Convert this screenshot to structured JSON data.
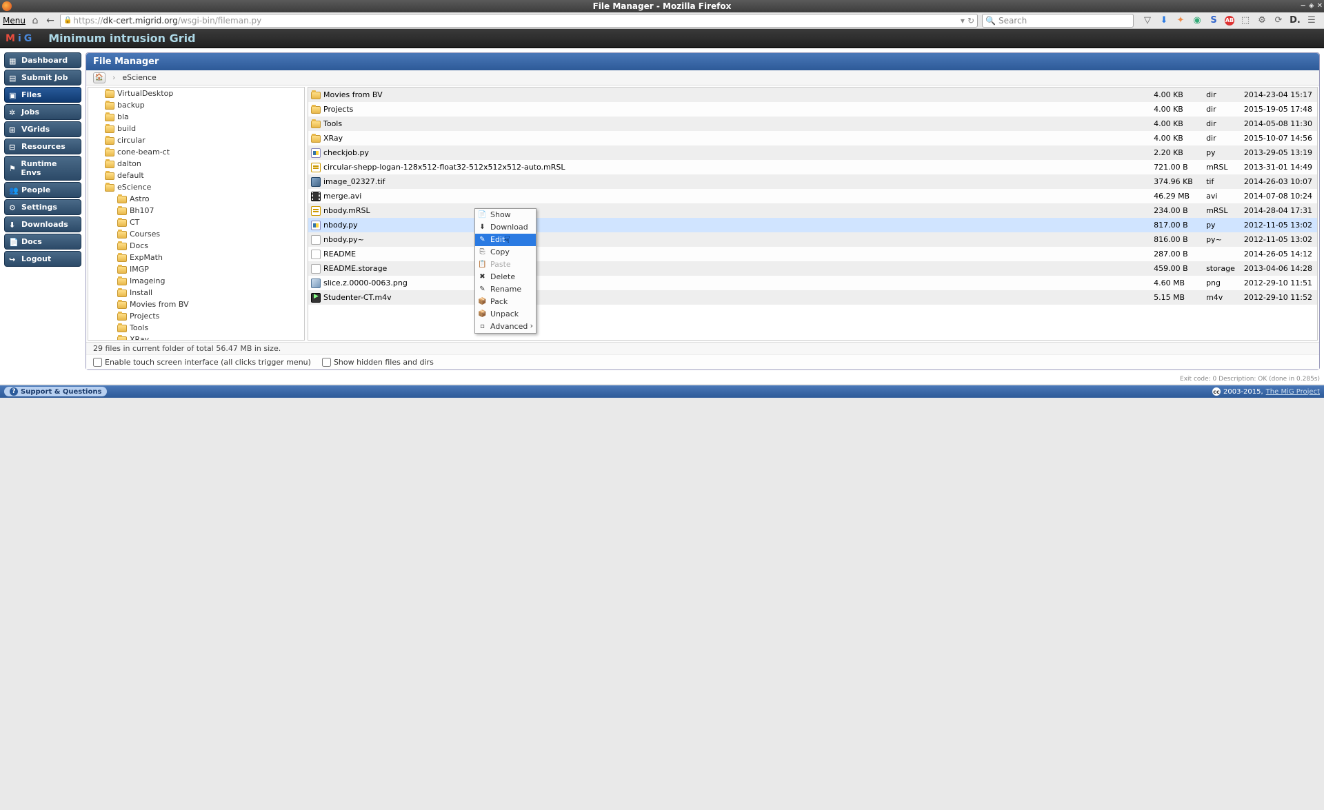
{
  "window": {
    "title": "File Manager - Mozilla Firefox"
  },
  "browser": {
    "menu_label": "Menu",
    "url_proto": "https://",
    "url_host": "dk-cert.migrid.org",
    "url_path": "/wsgi-bin/fileman.py",
    "search_placeholder": "Search"
  },
  "header": {
    "subtitle": "Minimum intrusion Grid"
  },
  "sidebar": [
    {
      "label": "Dashboard",
      "active": false,
      "icon": "dashboard-icon"
    },
    {
      "label": "Submit Job",
      "active": false,
      "icon": "submit-icon"
    },
    {
      "label": "Files",
      "active": true,
      "icon": "files-icon"
    },
    {
      "label": "Jobs",
      "active": false,
      "icon": "jobs-icon"
    },
    {
      "label": "VGrids",
      "active": false,
      "icon": "vgrids-icon"
    },
    {
      "label": "Resources",
      "active": false,
      "icon": "resources-icon"
    },
    {
      "label": "Runtime Envs",
      "active": false,
      "icon": "runtime-icon"
    },
    {
      "label": "People",
      "active": false,
      "icon": "people-icon"
    },
    {
      "label": "Settings",
      "active": false,
      "icon": "settings-icon"
    },
    {
      "label": "Downloads",
      "active": false,
      "icon": "downloads-icon"
    },
    {
      "label": "Docs",
      "active": false,
      "icon": "docs-icon"
    },
    {
      "label": "Logout",
      "active": false,
      "icon": "logout-icon"
    }
  ],
  "content": {
    "title": "File Manager",
    "breadcrumb": {
      "current": "eScience"
    },
    "tree": [
      {
        "name": "VirtualDesktop",
        "level": 1
      },
      {
        "name": "backup",
        "level": 1
      },
      {
        "name": "bla",
        "level": 1
      },
      {
        "name": "build",
        "level": 1
      },
      {
        "name": "circular",
        "level": 1
      },
      {
        "name": "cone-beam-ct",
        "level": 1
      },
      {
        "name": "dalton",
        "level": 1
      },
      {
        "name": "default",
        "level": 1
      },
      {
        "name": "eScience",
        "level": 1,
        "expanded": true
      },
      {
        "name": "Astro",
        "level": 2
      },
      {
        "name": "Bh107",
        "level": 2
      },
      {
        "name": "CT",
        "level": 2
      },
      {
        "name": "Courses",
        "level": 2
      },
      {
        "name": "Docs",
        "level": 2
      },
      {
        "name": "ExpMath",
        "level": 2
      },
      {
        "name": "IMGP",
        "level": 2
      },
      {
        "name": "Imageing",
        "level": 2
      },
      {
        "name": "Install",
        "level": 2
      },
      {
        "name": "Movies from BV",
        "level": 2
      },
      {
        "name": "Projects",
        "level": 2
      },
      {
        "name": "Tools",
        "level": 2
      },
      {
        "name": "XRay",
        "level": 2
      }
    ],
    "files": [
      {
        "name": "Movies from BV",
        "size": "4.00 KB",
        "type": "dir",
        "date": "2014-23-04 15:17",
        "ico": "ico-folder"
      },
      {
        "name": "Projects",
        "size": "4.00 KB",
        "type": "dir",
        "date": "2015-19-05 17:48",
        "ico": "ico-folder"
      },
      {
        "name": "Tools",
        "size": "4.00 KB",
        "type": "dir",
        "date": "2014-05-08 11:30",
        "ico": "ico-folder"
      },
      {
        "name": "XRay",
        "size": "4.00 KB",
        "type": "dir",
        "date": "2015-10-07 14:56",
        "ico": "ico-folder"
      },
      {
        "name": "checkjob.py",
        "size": "2.20 KB",
        "type": "py",
        "date": "2013-29-05 13:19",
        "ico": "ico-py"
      },
      {
        "name": "circular-shepp-logan-128x512-float32-512x512x512-auto.mRSL",
        "size": "721.00 B",
        "type": "mRSL",
        "date": "2013-31-01 14:49",
        "ico": "ico-mrsl"
      },
      {
        "name": "image_02327.tif",
        "size": "374.96 KB",
        "type": "tif",
        "date": "2014-26-03 10:07",
        "ico": "ico-tif"
      },
      {
        "name": "merge.avi",
        "size": "46.29 MB",
        "type": "avi",
        "date": "2014-07-08 10:24",
        "ico": "ico-avi"
      },
      {
        "name": "nbody.mRSL",
        "size": "234.00 B",
        "type": "mRSL",
        "date": "2014-28-04 17:31",
        "ico": "ico-mrsl"
      },
      {
        "name": "nbody.py",
        "size": "817.00 B",
        "type": "py",
        "date": "2012-11-05 13:02",
        "ico": "ico-py"
      },
      {
        "name": "nbody.py~",
        "size": "816.00 B",
        "type": "py~",
        "date": "2012-11-05 13:02",
        "ico": "ico-file"
      },
      {
        "name": "README",
        "size": "287.00 B",
        "type": "",
        "date": "2014-26-05 14:12",
        "ico": "ico-file"
      },
      {
        "name": "README.storage",
        "size": "459.00 B",
        "type": "storage",
        "date": "2013-04-06 14:28",
        "ico": "ico-file"
      },
      {
        "name": "slice.z.0000-0063.png",
        "size": "4.60 MB",
        "type": "png",
        "date": "2012-29-10 11:51",
        "ico": "ico-png"
      },
      {
        "name": "Studenter-CT.m4v",
        "size": "5.15 MB",
        "type": "m4v",
        "date": "2012-29-10 11:52",
        "ico": "ico-m4v"
      }
    ],
    "context_menu": [
      {
        "label": "Show",
        "ico": "📄"
      },
      {
        "label": "Download",
        "ico": "⬇"
      },
      {
        "label": "Edit",
        "ico": "✎",
        "highlighted": true
      },
      {
        "label": "Copy",
        "ico": "⎘"
      },
      {
        "label": "Paste",
        "ico": "📋",
        "disabled": true
      },
      {
        "label": "Delete",
        "ico": "✖"
      },
      {
        "label": "Rename",
        "ico": "✎"
      },
      {
        "label": "Pack",
        "ico": "📦"
      },
      {
        "label": "Unpack",
        "ico": "📦"
      },
      {
        "label": "Advanced",
        "ico": "▫",
        "submenu": true
      }
    ],
    "status": "29 files in current folder of total 56.47 MB in size.",
    "options": {
      "touch_label": "Enable touch screen interface (all clicks trigger menu)",
      "hidden_label": "Show hidden files and dirs"
    }
  },
  "exit_code": "Exit code: 0 Description: OK (done in 0.285s)",
  "footer": {
    "support": "Support & Questions",
    "copyright": "2003-2015,",
    "link": "The MiG Project"
  }
}
